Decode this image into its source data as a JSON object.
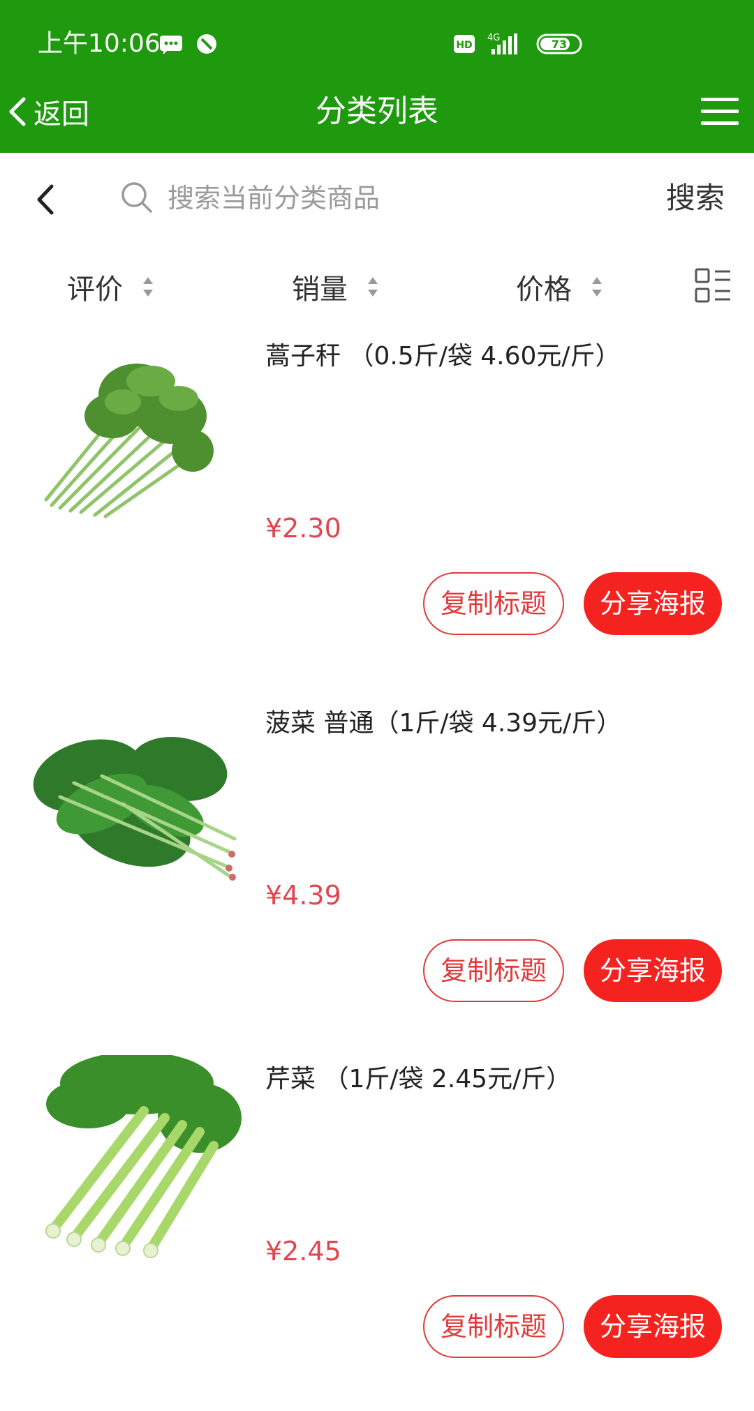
{
  "status_bar": {
    "time": "上午10:06",
    "network": "4G",
    "hd": "HD",
    "battery": "73"
  },
  "nav": {
    "back_label": "返回",
    "title": "分类列表"
  },
  "search": {
    "placeholder": "搜索当前分类商品",
    "button_label": "搜索"
  },
  "sort": {
    "items": [
      {
        "label": "评价"
      },
      {
        "label": "销量"
      },
      {
        "label": "价格"
      }
    ]
  },
  "products": [
    {
      "title": "蒿子秆 （0.5斤/袋 4.60元/斤）",
      "price": "¥2.30",
      "copy_label": "复制标题",
      "share_label": "分享海报"
    },
    {
      "title": "菠菜 普通（1斤/袋 4.39元/斤）",
      "price": "¥4.39",
      "copy_label": "复制标题",
      "share_label": "分享海报"
    },
    {
      "title": "芹菜 （1斤/袋 2.45元/斤）",
      "price": "¥2.45",
      "copy_label": "复制标题",
      "share_label": "分享海报"
    }
  ],
  "colors": {
    "header_green": "#1f9a0e",
    "price_red": "#e0464f",
    "button_red": "#f4231f"
  }
}
